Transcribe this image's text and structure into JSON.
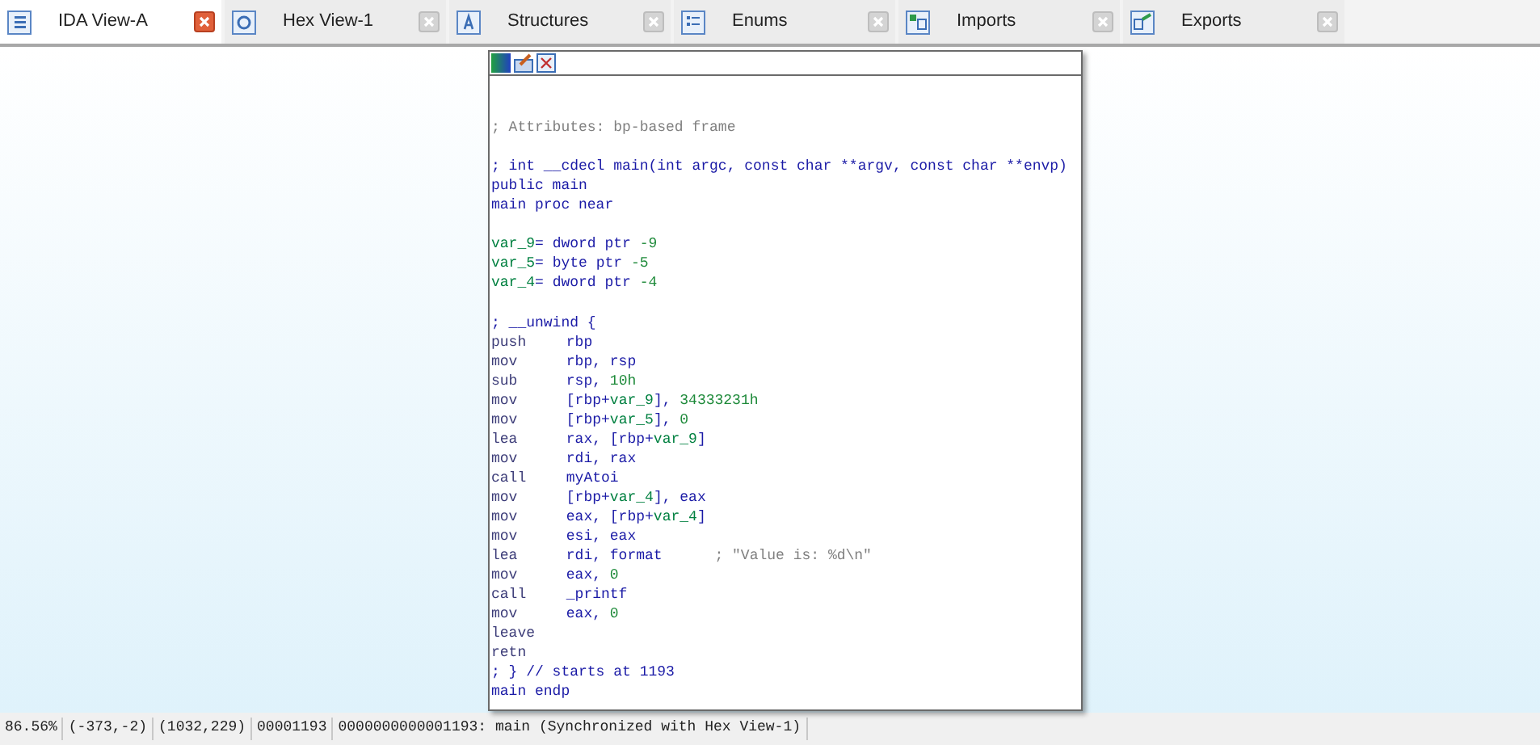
{
  "tabs": [
    {
      "label": "IDA View-A",
      "selected": true
    },
    {
      "label": "Hex View-1",
      "selected": false
    },
    {
      "label": "Structures",
      "selected": false
    },
    {
      "label": "Enums",
      "selected": false
    },
    {
      "label": "Imports",
      "selected": false
    },
    {
      "label": "Exports",
      "selected": false
    }
  ],
  "graph_node": {
    "lines": [
      {
        "kind": "blank"
      },
      {
        "kind": "blank"
      },
      {
        "kind": "text",
        "segments": [
          {
            "text": "; Attributes: bp-based frame",
            "kind": "comment"
          }
        ]
      },
      {
        "kind": "blank"
      },
      {
        "kind": "text",
        "segments": [
          {
            "text": "; int __cdecl main(int argc, const char **argv, const char **envp)",
            "kind": "code"
          }
        ]
      },
      {
        "kind": "text",
        "segments": [
          {
            "text": "public main",
            "kind": "code"
          }
        ]
      },
      {
        "kind": "text",
        "segments": [
          {
            "text": "main proc near",
            "kind": "code"
          }
        ]
      },
      {
        "kind": "blank"
      },
      {
        "kind": "text",
        "segments": [
          {
            "text": "var_9",
            "kind": "var"
          },
          {
            "text": "= dword ptr ",
            "kind": "code"
          },
          {
            "text": "-9",
            "kind": "number"
          }
        ]
      },
      {
        "kind": "text",
        "segments": [
          {
            "text": "var_5",
            "kind": "var"
          },
          {
            "text": "= byte ptr ",
            "kind": "code"
          },
          {
            "text": "-5",
            "kind": "number"
          }
        ]
      },
      {
        "kind": "text",
        "segments": [
          {
            "text": "var_4",
            "kind": "var"
          },
          {
            "text": "= dword ptr ",
            "kind": "code"
          },
          {
            "text": "-4",
            "kind": "number"
          }
        ]
      },
      {
        "kind": "blank"
      },
      {
        "kind": "text",
        "segments": [
          {
            "text": "; __unwind {",
            "kind": "code"
          }
        ]
      },
      {
        "kind": "insn",
        "mnemonic": "push",
        "segments": [
          {
            "text": "rbp",
            "kind": "code"
          }
        ]
      },
      {
        "kind": "insn",
        "mnemonic": "mov",
        "segments": [
          {
            "text": "rbp, rsp",
            "kind": "code"
          }
        ]
      },
      {
        "kind": "insn",
        "mnemonic": "sub",
        "segments": [
          {
            "text": "rsp, ",
            "kind": "code"
          },
          {
            "text": "10h",
            "kind": "number"
          }
        ]
      },
      {
        "kind": "insn",
        "mnemonic": "mov",
        "segments": [
          {
            "text": "[rbp+",
            "kind": "code"
          },
          {
            "text": "var_9",
            "kind": "var"
          },
          {
            "text": "], ",
            "kind": "code"
          },
          {
            "text": "34333231h",
            "kind": "number"
          }
        ]
      },
      {
        "kind": "insn",
        "mnemonic": "mov",
        "segments": [
          {
            "text": "[rbp+",
            "kind": "code"
          },
          {
            "text": "var_5",
            "kind": "var"
          },
          {
            "text": "], ",
            "kind": "code"
          },
          {
            "text": "0",
            "kind": "number"
          }
        ]
      },
      {
        "kind": "insn",
        "mnemonic": "lea",
        "segments": [
          {
            "text": "rax, [rbp+",
            "kind": "code"
          },
          {
            "text": "var_9",
            "kind": "var"
          },
          {
            "text": "]",
            "kind": "code"
          }
        ]
      },
      {
        "kind": "insn",
        "mnemonic": "mov",
        "segments": [
          {
            "text": "rdi, rax",
            "kind": "code"
          }
        ]
      },
      {
        "kind": "insn",
        "mnemonic": "call",
        "segments": [
          {
            "text": "myAtoi",
            "kind": "code"
          }
        ]
      },
      {
        "kind": "insn",
        "mnemonic": "mov",
        "segments": [
          {
            "text": "[rbp+",
            "kind": "code"
          },
          {
            "text": "var_4",
            "kind": "var"
          },
          {
            "text": "], eax",
            "kind": "code"
          }
        ]
      },
      {
        "kind": "insn",
        "mnemonic": "mov",
        "segments": [
          {
            "text": "eax, [rbp+",
            "kind": "code"
          },
          {
            "text": "var_4",
            "kind": "var"
          },
          {
            "text": "]",
            "kind": "code"
          }
        ]
      },
      {
        "kind": "insn",
        "mnemonic": "mov",
        "segments": [
          {
            "text": "esi, eax",
            "kind": "code"
          }
        ]
      },
      {
        "kind": "insn",
        "mnemonic": "lea",
        "segments": [
          {
            "text": "rdi, format      ",
            "kind": "code"
          },
          {
            "text": "; \"Value is: %d\\n\"",
            "kind": "comment"
          }
        ]
      },
      {
        "kind": "insn",
        "mnemonic": "mov",
        "segments": [
          {
            "text": "eax, ",
            "kind": "code"
          },
          {
            "text": "0",
            "kind": "number"
          }
        ]
      },
      {
        "kind": "insn",
        "mnemonic": "call",
        "segments": [
          {
            "text": "_printf",
            "kind": "code"
          }
        ]
      },
      {
        "kind": "insn",
        "mnemonic": "mov",
        "segments": [
          {
            "text": "eax, ",
            "kind": "code"
          },
          {
            "text": "0",
            "kind": "number"
          }
        ]
      },
      {
        "kind": "insn",
        "mnemonic": "leave"
      },
      {
        "kind": "insn",
        "mnemonic": "retn"
      },
      {
        "kind": "text",
        "segments": [
          {
            "text": "; } // starts at 1193",
            "kind": "code"
          }
        ]
      },
      {
        "kind": "text",
        "segments": [
          {
            "text": "main endp",
            "kind": "code"
          }
        ]
      }
    ]
  },
  "status_bar": [
    "86.56%",
    "(-373,-2)",
    "(1032,229)",
    "00001193",
    "0000000000001193: main (Synchronized with Hex View-1)"
  ]
}
